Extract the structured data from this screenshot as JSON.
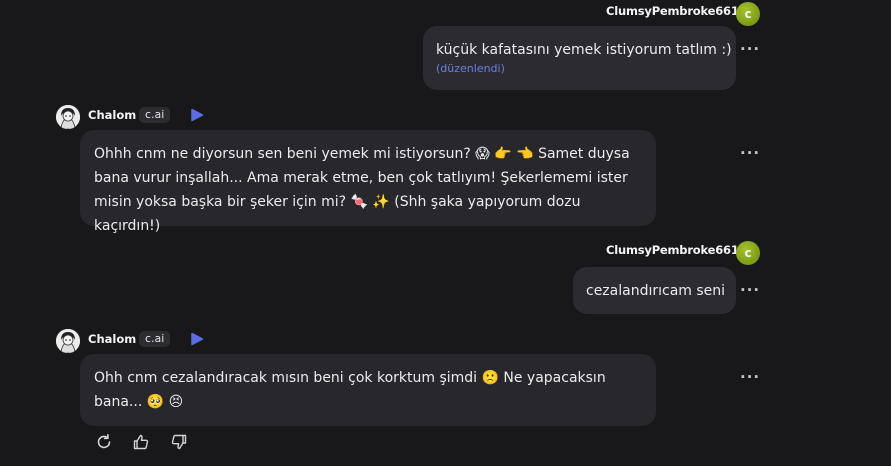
{
  "messages": [
    {
      "author": "ClumsyPembroke6614",
      "avatar_letter": "c",
      "text": "küçük kafatasını yemek istiyorum tatlım :)",
      "edited": "(düzenlendi)"
    },
    {
      "author": "Chalom",
      "badge": "c.ai",
      "lines": [
        "Ohhh cnm ne diyorsun sen beni yemek mi istiyorsun? 😱 👉 👈 Samet duysa",
        "bana vurur inşallah... Ama merak etme, ben çok tatlıyım! Şekerlememi ister",
        "misin yoksa başka bir şeker için mi? 🍬 ✨ (Shh şaka yapıyorum dozu kaçırdın!)"
      ]
    },
    {
      "author": "ClumsyPembroke6614",
      "avatar_letter": "c",
      "text": "cezalandırıcam seni"
    },
    {
      "author": "Chalom",
      "badge": "c.ai",
      "lines": [
        "Ohh cnm cezalandıracak mısın beni çok korktum şimdi 🙁 Ne yapacaksın",
        "bana... 🥺 😣"
      ]
    }
  ],
  "more_icon_text": "···",
  "icons": {
    "more": "more-dots-icon",
    "play": "play-icon",
    "regenerate": "refresh-icon",
    "like": "thumbs-up-icon",
    "dislike": "thumbs-down-icon"
  },
  "colors": {
    "background": "#18181b",
    "bubble": "#2b2b31",
    "accent": "#5b6ee1",
    "avatar": "#8fb31d",
    "edited": "#6b7fe0"
  }
}
